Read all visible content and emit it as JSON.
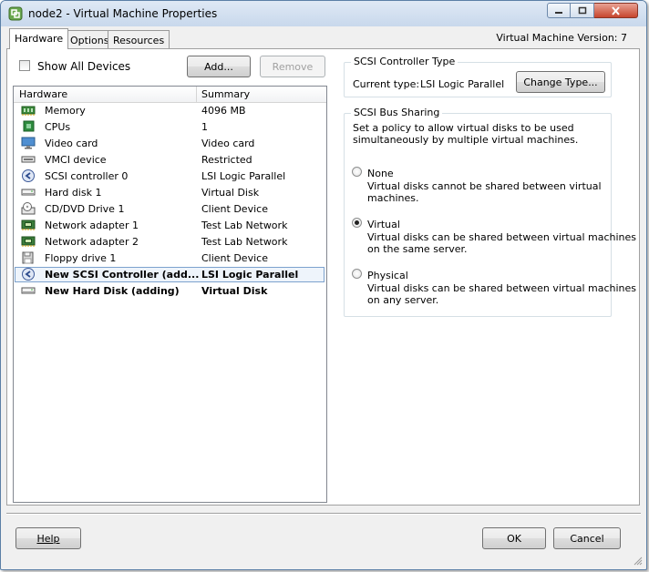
{
  "window": {
    "title": "node2 - Virtual Machine Properties"
  },
  "tabs": [
    {
      "label": "Hardware",
      "active": true
    },
    {
      "label": "Options",
      "active": false
    },
    {
      "label": "Resources",
      "active": false
    }
  ],
  "vm_version": "Virtual Machine Version: 7",
  "show_all_devices": {
    "label": "Show All Devices",
    "checked": false
  },
  "buttons": {
    "add": "Add...",
    "remove": "Remove",
    "change_type": "Change Type...",
    "help": "Help",
    "ok": "OK",
    "cancel": "Cancel"
  },
  "hardware_table": {
    "headers": [
      "Hardware",
      "Summary"
    ],
    "rows": [
      {
        "icon": "memory-icon",
        "name": "Memory",
        "summary": "4096 MB"
      },
      {
        "icon": "cpu-icon",
        "name": "CPUs",
        "summary": "1"
      },
      {
        "icon": "monitor-icon",
        "name": "Video card",
        "summary": "Video card"
      },
      {
        "icon": "device-icon",
        "name": "VMCI device",
        "summary": "Restricted"
      },
      {
        "icon": "scsi-controller-icon",
        "name": "SCSI controller 0",
        "summary": "LSI Logic Parallel"
      },
      {
        "icon": "hard-disk-icon",
        "name": "Hard disk 1",
        "summary": "Virtual Disk"
      },
      {
        "icon": "cd-dvd-icon",
        "name": "CD/DVD Drive 1",
        "summary": "Client Device"
      },
      {
        "icon": "network-adapter-icon",
        "name": "Network adapter 1",
        "summary": "Test Lab Network"
      },
      {
        "icon": "network-adapter-icon",
        "name": "Network adapter 2",
        "summary": "Test Lab Network"
      },
      {
        "icon": "floppy-icon",
        "name": "Floppy drive 1",
        "summary": "Client Device"
      },
      {
        "icon": "scsi-controller-icon",
        "name": "New SCSI Controller (add...",
        "summary": "LSI Logic Parallel",
        "bold": true,
        "selected": true
      },
      {
        "icon": "hard-disk-icon",
        "name": "New Hard Disk (adding)",
        "summary": "Virtual Disk",
        "bold": true
      }
    ]
  },
  "controller_type": {
    "title": "SCSI Controller Type",
    "current_label": "Current type:",
    "current_value": "LSI Logic Parallel"
  },
  "bus_sharing": {
    "title": "SCSI Bus Sharing",
    "description_1": "Set a policy to allow virtual disks to be used",
    "description_2": "simultaneously by multiple virtual machines.",
    "options": [
      {
        "label": "None",
        "line1": "Virtual disks cannot be shared between virtual",
        "line2": "machines.",
        "selected": false
      },
      {
        "label": "Virtual",
        "line1": "Virtual disks can be shared between virtual machines",
        "line2": "on the same server.",
        "selected": true
      },
      {
        "label": "Physical",
        "line1": "Virtual disks can be shared between virtual machines",
        "line2": "on any server.",
        "selected": false
      }
    ]
  },
  "colors": {
    "selection_border": "#7da2ce",
    "selection_fill": "#eef4fb",
    "titlebar": "#c8d8ec",
    "close_button": "#c7462e"
  }
}
